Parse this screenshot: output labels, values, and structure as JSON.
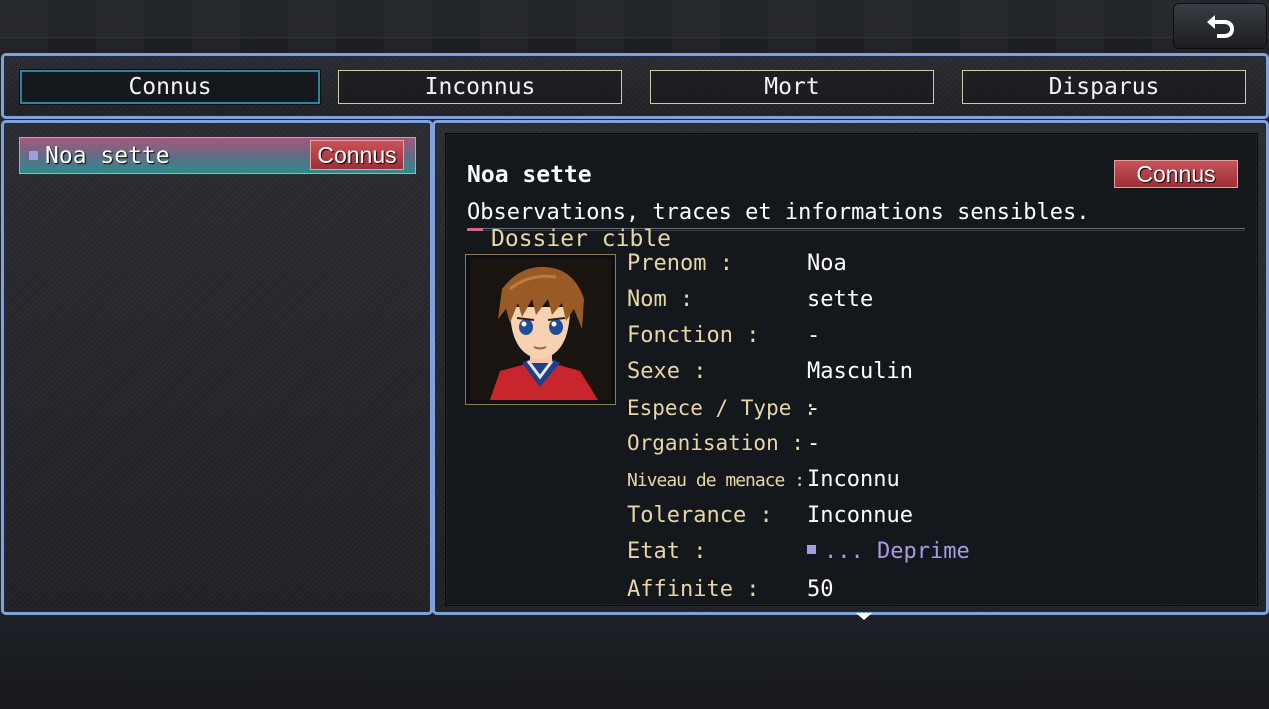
{
  "tabs": [
    {
      "label": "Connus",
      "active": true
    },
    {
      "label": "Inconnus",
      "active": false
    },
    {
      "label": "Mort",
      "active": false
    },
    {
      "label": "Disparus",
      "active": false
    }
  ],
  "list": {
    "items": [
      {
        "name": "Noa sette",
        "status": "Connus"
      }
    ]
  },
  "detail": {
    "name": "Noa sette",
    "status": "Connus",
    "description": "Observations, traces et informations sensibles.",
    "section_title": "Dossier cible",
    "fields": [
      {
        "label": "Prenom :",
        "value": "Noa"
      },
      {
        "label": "Nom :",
        "value": "sette"
      },
      {
        "label": "Fonction :",
        "value": "-"
      },
      {
        "label": "Sexe :",
        "value": "Masculin"
      },
      {
        "label": "Espece / Type :",
        "value": "-"
      },
      {
        "label": "Organisation :",
        "value": "-"
      },
      {
        "label": "Niveau de menace :",
        "value": "Inconnu"
      },
      {
        "label": "Tolerance :",
        "value": "Inconnue"
      },
      {
        "label": "Etat :",
        "value": "... Deprime"
      },
      {
        "label": "Affinite :",
        "value": "50"
      }
    ]
  },
  "icons": {
    "back": "back-arrow-icon",
    "scroll": "scroll-down-arrow-icon"
  },
  "colors": {
    "window_border": "#7fa2dc",
    "status_badge": "#b8434c",
    "label_text": "#e6d6a8",
    "state_text": "#a79be0"
  }
}
